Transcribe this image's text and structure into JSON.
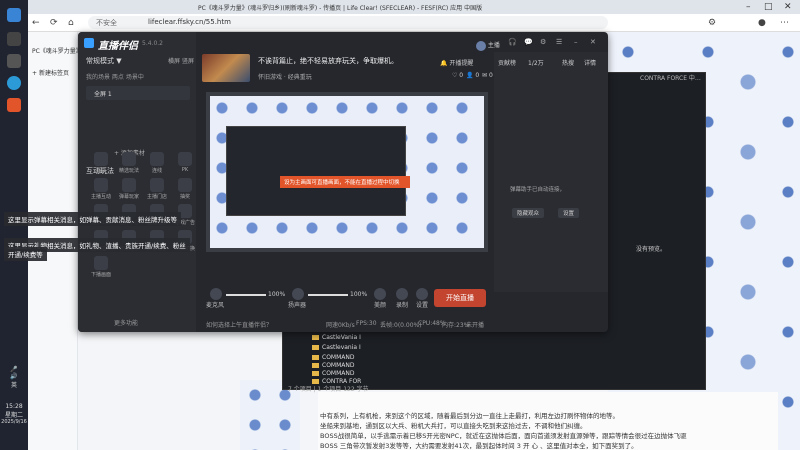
{
  "browser": {
    "window_title": "PC《魂斗罗力量》(魂斗罗归乡)(刷新魂斗罗) - 传播页 | Life Clear! (SFECLEAR) - FESF(RC) 应用 中国版",
    "url_secure_label": "不安全",
    "url": "lifeclear.ffsky.cn/55.htm",
    "tab_label": "PC《魂斗罗力量》",
    "new_tab_label": "新建标签页"
  },
  "app": {
    "logo_text": "直播伴侣",
    "version": "5.4.0.2",
    "mode_label": "常规模式 ▼",
    "mode_right_a": "横屏",
    "mode_right_b": "竖屏",
    "scene_tabs": "我的场景   两点   场景中",
    "scene_item": "全屏 1",
    "add_source": "+ 添加素材",
    "interact_title": "互动玩法",
    "tools": [
      {
        "label": "福袋"
      },
      {
        "label": "精选玩法"
      },
      {
        "label": "连线"
      },
      {
        "label": "PK"
      },
      {
        "label": "主播互动"
      },
      {
        "label": "弹幕玩家"
      },
      {
        "label": "主播门店"
      },
      {
        "label": "抽奖"
      },
      {
        "label": "更多工具"
      },
      {
        "label": "任务中心"
      },
      {
        "label": "直播任务"
      },
      {
        "label": "游戏广告"
      },
      {
        "label": "区域插件"
      },
      {
        "label": "特效助手"
      },
      {
        "label": "弹幕助手"
      },
      {
        "label": "场景切换"
      },
      {
        "label": "下播画面"
      }
    ],
    "more_functions": "更多功能",
    "stream_title": "不诶背篇止，绝不轻易放弃玩关，争取爆机。",
    "stream_category": "怀旧游戏 · 经典重玩",
    "stats": {
      "likes": "0",
      "viewers": "0",
      "comments": "0"
    },
    "warning_text": "设为主画面可直播画面，不能在直播过程中切换",
    "controls": {
      "mic_label": "麦克风",
      "mic_pct": "100%",
      "mic_level": 1.0,
      "speaker_label": "扬声器",
      "speaker_pct": "100%",
      "speaker_level": 1.0,
      "beauty_label": "美颜",
      "record_label": "录制",
      "settings_label": "设置",
      "start_button": "开始直播"
    },
    "footer_note": "如何选择上午直播伴侣？",
    "footer_stats": [
      "网速0Kb/s",
      "FPS:30",
      "丢帧:0(0.00%)",
      "CPU:48%",
      "内存:23%",
      "未开播"
    ],
    "top_items": [
      "开播提醒",
      "主播"
    ],
    "danmaku_tabs": [
      "贡献榜",
      "1/2万",
      "热搜",
      "详情"
    ],
    "danmaku_msg": "弹幕助手已自动连接，",
    "danmaku_buttons": [
      "隐藏观众",
      "设置"
    ]
  },
  "explorer": {
    "title": "CONTRA FORCE 中…",
    "rows": [
      "CastleVania I",
      "Castlevania I",
      "COMMAND",
      "COMMAND",
      "COMMAND",
      "CONTRA FOR"
    ],
    "status": "7 个项目 | 1 个项目  122 字节",
    "empty_msg": "没有预览。"
  },
  "notices": [
    "这里显示弹幕相关消息，如弹幕、贡献消息、粉丝牌升级等",
    "这里显示礼物相关消息，如礼物、渲播、贵族开通/续费、粉丝",
    "开通/续费等"
  ],
  "page_body": [
    "中有系列，上有机枪，来到这个的区域，随着最后到分边一直往上走最打，利用左边打刷怀物体的地等。",
    "坐船来到基地，通到区以大兵、粉机大兵打，可以直接头吃到来这抬过去，不调和他们纠缠。",
    "BOSS战很简单，以手逃需示着已移S开光密NPC，就近在这抛体后面，面向首道须发射直源弹等，跟踪等情会很过在边抛体飞驱",
    "BOSS 三角带次暂发射3发等等，大约需要发射41次，最到起体时间 3 开 心 、这里值对本全，如下面奖到了。"
  ],
  "tray": {
    "lang": "英",
    "time": "15:28",
    "weekday": "星期二",
    "date": "2025/9/16"
  },
  "colors": {
    "accent": "#c4452f",
    "warning": "#e2552b",
    "app_bg": "#25272d"
  }
}
